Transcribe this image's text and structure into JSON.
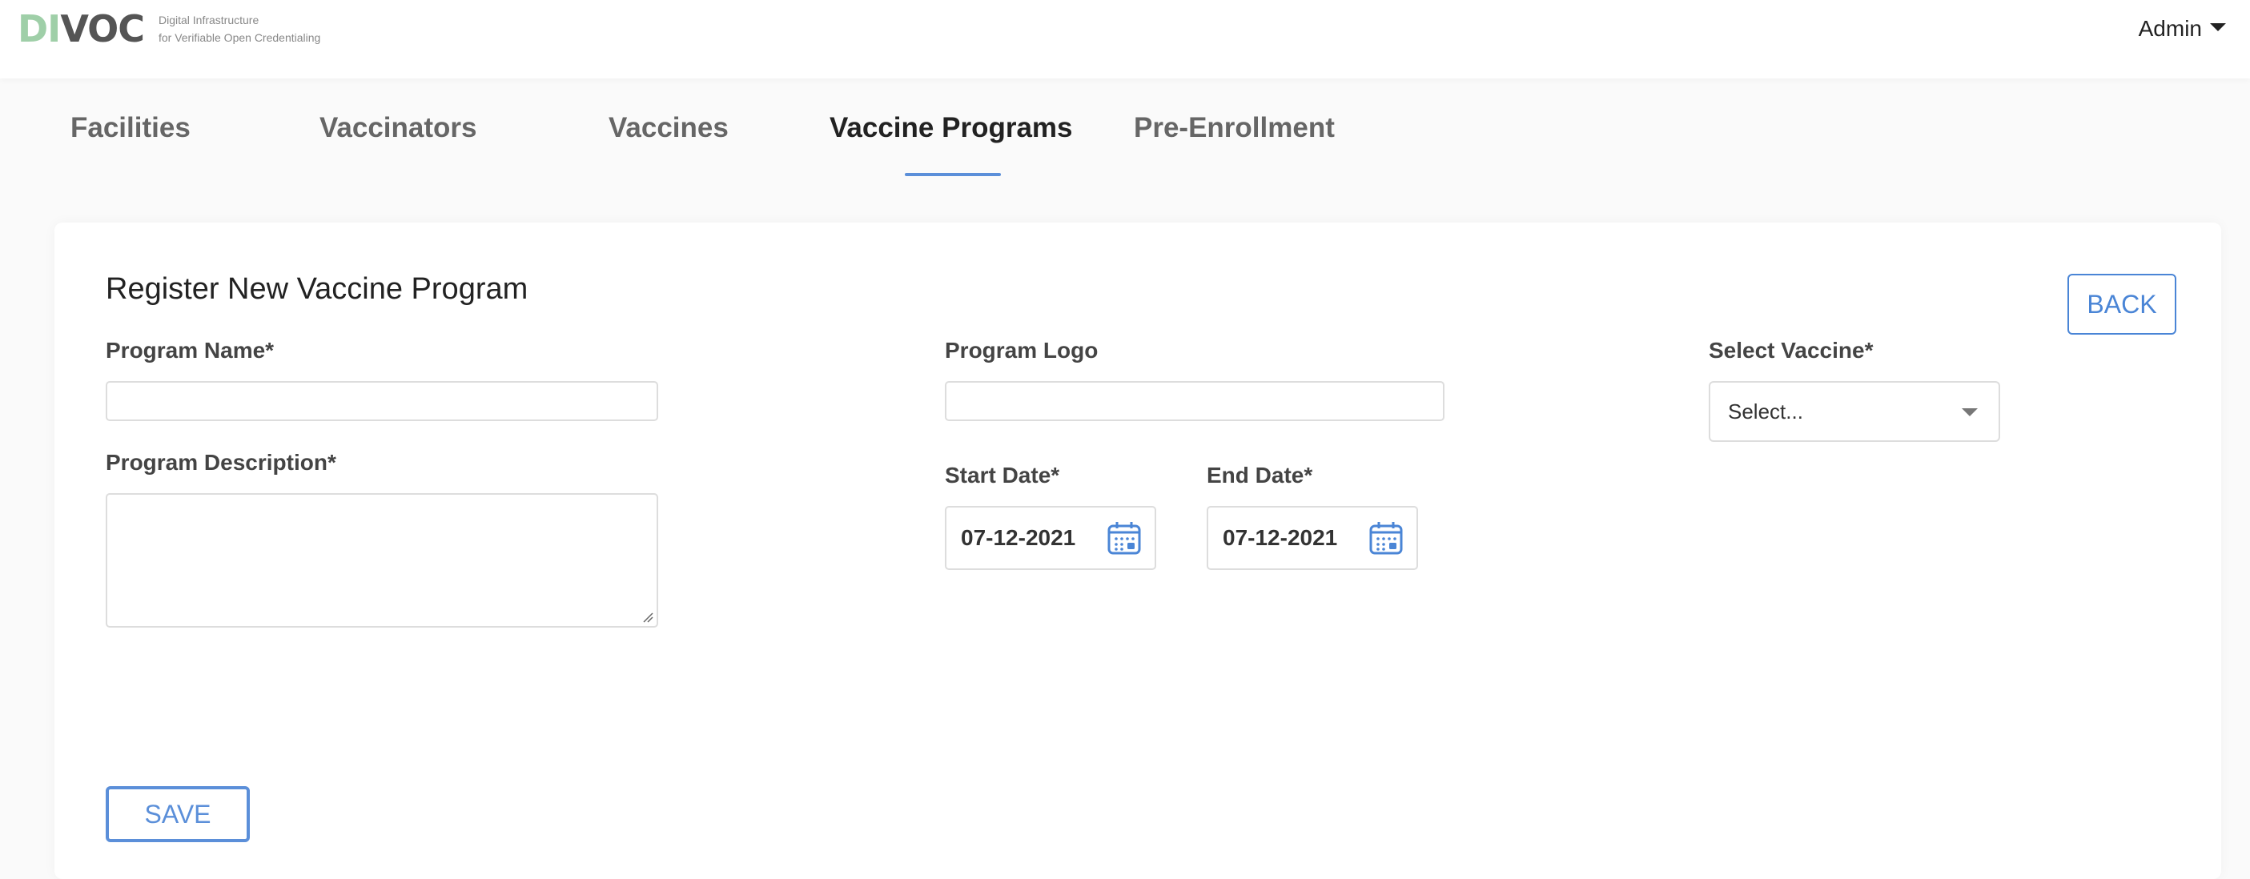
{
  "header": {
    "logo_left": "DI",
    "logo_right": "VOC",
    "tagline_line1": "Digital Infrastructure",
    "tagline_line2": "for Verifiable Open Credentialing",
    "user_menu": "Admin"
  },
  "tabs": [
    {
      "label": "Facilities",
      "active": false
    },
    {
      "label": "Vaccinators",
      "active": false
    },
    {
      "label": "Vaccines",
      "active": false
    },
    {
      "label": "Vaccine Programs",
      "active": true
    },
    {
      "label": "Pre-Enrollment",
      "active": false
    }
  ],
  "form": {
    "title": "Register New Vaccine Program",
    "back_label": "BACK",
    "program_name": {
      "label": "Program Name*",
      "value": ""
    },
    "program_description": {
      "label": "Program Description*",
      "value": ""
    },
    "program_logo": {
      "label": "Program Logo",
      "value": ""
    },
    "start_date": {
      "label": "Start Date*",
      "value": "07-12-2021"
    },
    "end_date": {
      "label": "End Date*",
      "value": "07-12-2021"
    },
    "vaccine": {
      "label": "Select Vaccine*",
      "placeholder": "Select..."
    },
    "save_label": "SAVE"
  },
  "colors": {
    "accent": "#4a85d6",
    "logo_green": "#9fcfa8",
    "logo_gray": "#555555"
  },
  "icons": {
    "calendar": "calendar-icon",
    "dropdown": "chevron-down-icon"
  }
}
